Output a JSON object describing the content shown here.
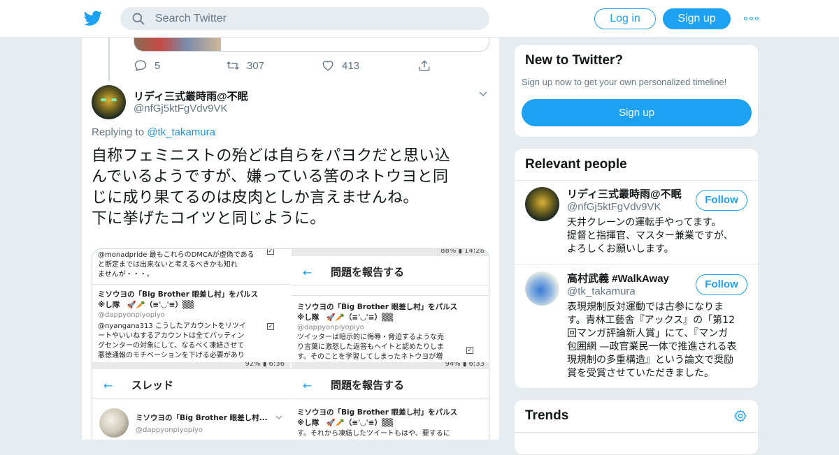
{
  "header": {
    "search_placeholder": "Search Twitter",
    "login_label": "Log in",
    "signup_label": "Sign up"
  },
  "colors": {
    "accent": "#1da1f2",
    "background": "#e6ecf0",
    "text": "#14171a",
    "muted": "#657786"
  },
  "previous_tweet": {
    "replies": "5",
    "retweets": "307",
    "likes": "413"
  },
  "tweet": {
    "display_name": "リディ三式叢時雨@不眠",
    "handle": "@nfGj5ktFgVdv9VK",
    "replying_prefix": "Replying to",
    "replying_to": "@tk_takamura",
    "text_lines": [
      "自称フェミニストの殆どは自らをパヨクだと思い込",
      "んでいるようですが、嫌っている筈のネトウヨと同",
      "じに成り果てるのは皮肉としか言えませんね。",
      "下に挙げたコイツと同じように。"
    ],
    "media": {
      "tl": {
        "lines": [
          "@monadpride 最もこれらのDMCAが虚偽である",
          "と断定までは出来ないと考えるべきかも知れ",
          "ませんが・・・。"
        ],
        "name": "ミソウヨの「Big Brother 眼差し村」をパルス",
        "name2": "※し隊　🚀🥕（≡ˈ◡ˈ≡）▒▒",
        "handle": "@dappyonpiyopiyo",
        "reply_lines": [
          "@nyangana313 こうしたアカウントをリツイ",
          "ートやいいねするアカウントは全てバッティン",
          "グセンターの対象にして、なるべく凍結させて",
          "悪徳通報のモチベーションを下げる必要があり"
        ]
      },
      "tr": {
        "status": "88% ▮ 14:28",
        "title": "問題を報告する",
        "back": "←",
        "name": "ミソウヨの「Big Brother 眼差し村」をパルス",
        "name2": "※し隊　🚀🥕（≡ˈ◡ˈ≡）▒▒",
        "handle": "@dappyonpiyopiyo",
        "lines": [
          "ツイッターは暗示的に侮辱・脅迫するような売",
          "り言葉に激怒した返答もヘイトと認めたりしま",
          "す。そのことを学習してしまったネトウヨが増"
        ]
      },
      "bl": {
        "status": "92% ▮ 6:36",
        "title": "スレッド",
        "back": "←",
        "name": "ミソウヨの「Big Brother 眼差し村...",
        "handle": "@dappyonpiyopiyo"
      },
      "br": {
        "status": "94% ▮ 6:33",
        "title": "問題を報告する",
        "back": "←",
        "name": "ミソウヨの「Big Brother 眼差し村」をパルス",
        "name2": "※し隊　🚀🥕（≡ˈ◡ˈ≡）▒▒",
        "line": "す。それから凍結したツイートもはや、要するに"
      }
    }
  },
  "sidebar": {
    "new_title": "New to Twitter?",
    "new_text": "Sign up now to get your own personalized timeline!",
    "new_signup": "Sign up",
    "relevant_title": "Relevant people",
    "people": [
      {
        "name": "リディ三式叢時雨@不眠",
        "handle": "@nfGj5ktFgVdv9VK",
        "follow": "Follow",
        "bio_lines": [
          "天井クレーンの運転手やってます。",
          "提督と指揮官、マスター兼業ですが、",
          "よろしくお願いします。"
        ]
      },
      {
        "name": "高村武義 #WalkAway",
        "handle": "@tk_takamura",
        "follow": "Follow",
        "bio_lines": [
          "表現規制反対運動では古参になりま",
          "す。青林工藝舎『アックス』の「第12",
          "回マンガ評論新人賞」にて、『マンガ",
          "包囲網 —政官業民一体で推進される表",
          "現規制の多重構造』という論文で奨励",
          "賞を受賞させていただきました。"
        ]
      }
    ],
    "trends_title": "Trends"
  }
}
